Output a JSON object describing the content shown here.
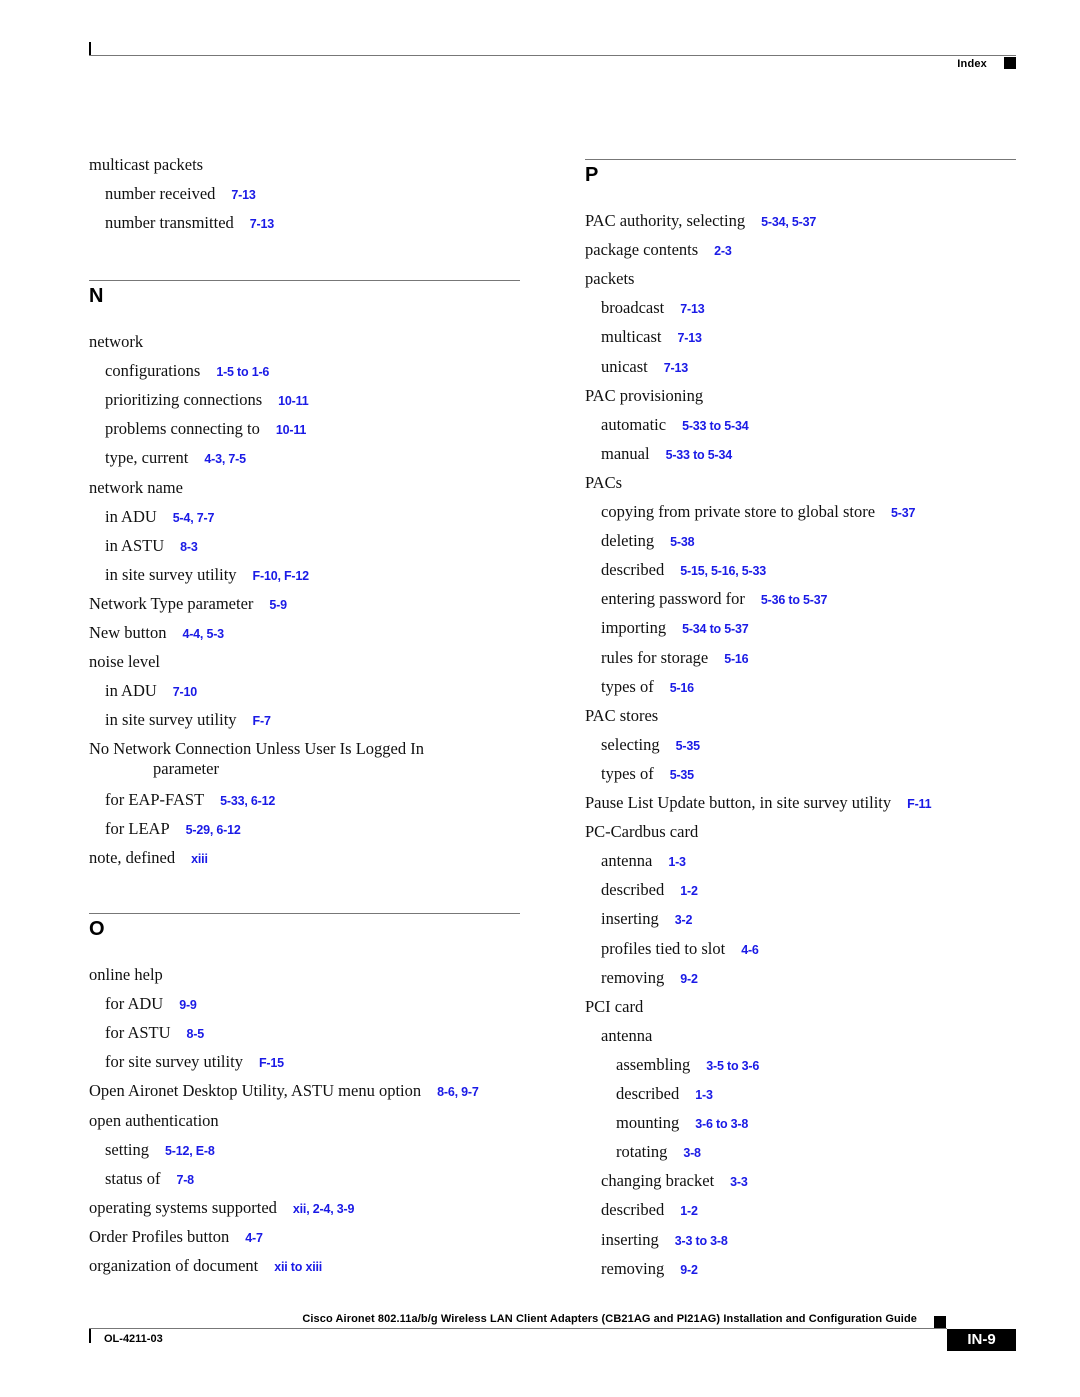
{
  "header": {
    "section_label": "Index"
  },
  "left_column": {
    "continued_entries": [
      {
        "level": 0,
        "term": "multicast packets",
        "refs": ""
      },
      {
        "level": 1,
        "term": "number received",
        "refs": "7-13"
      },
      {
        "level": 1,
        "term": "number transmitted",
        "refs": "7-13"
      }
    ],
    "sections": [
      {
        "letter": "N",
        "entries": [
          {
            "level": 0,
            "term": "network",
            "refs": ""
          },
          {
            "level": 1,
            "term": "configurations",
            "refs": "1-5 to 1-6"
          },
          {
            "level": 1,
            "term": "prioritizing connections",
            "refs": "10-11"
          },
          {
            "level": 1,
            "term": "problems connecting to",
            "refs": "10-11"
          },
          {
            "level": 1,
            "term": "type, current",
            "refs": "4-3, 7-5"
          },
          {
            "level": 0,
            "term": "network name",
            "refs": ""
          },
          {
            "level": 1,
            "term": "in ADU",
            "refs": "5-4, 7-7"
          },
          {
            "level": 1,
            "term": "in ASTU",
            "refs": "8-3"
          },
          {
            "level": 1,
            "term": "in site survey utility",
            "refs": "F-10, F-12"
          },
          {
            "level": 0,
            "term": "Network Type parameter",
            "refs": "5-9"
          },
          {
            "level": 0,
            "term": "New button",
            "refs": "4-4, 5-3"
          },
          {
            "level": 0,
            "term": "noise level",
            "refs": ""
          },
          {
            "level": 1,
            "term": "in ADU",
            "refs": "7-10"
          },
          {
            "level": 1,
            "term": "in site survey utility",
            "refs": "F-7"
          },
          {
            "level": 0,
            "term": "No Network Connection Unless User Is Logged In",
            "continuation": "parameter",
            "refs": ""
          },
          {
            "level": 1,
            "term": "for EAP-FAST",
            "refs": "5-33, 6-12"
          },
          {
            "level": 1,
            "term": "for LEAP",
            "refs": "5-29, 6-12"
          },
          {
            "level": 0,
            "term": "note, defined",
            "refs": "xiii"
          }
        ]
      },
      {
        "letter": "O",
        "entries": [
          {
            "level": 0,
            "term": "online help",
            "refs": ""
          },
          {
            "level": 1,
            "term": "for ADU",
            "refs": "9-9"
          },
          {
            "level": 1,
            "term": "for ASTU",
            "refs": "8-5"
          },
          {
            "level": 1,
            "term": "for site survey utility",
            "refs": "F-15"
          },
          {
            "level": 0,
            "term": "Open Aironet Desktop Utility, ASTU menu option",
            "refs": "8-6, 9-7"
          },
          {
            "level": 0,
            "term": "open authentication",
            "refs": ""
          },
          {
            "level": 1,
            "term": "setting",
            "refs": "5-12, E-8"
          },
          {
            "level": 1,
            "term": "status of",
            "refs": "7-8"
          },
          {
            "level": 0,
            "term": "operating systems supported",
            "refs": "xii, 2-4, 3-9"
          },
          {
            "level": 0,
            "term": "Order Profiles button",
            "refs": "4-7"
          },
          {
            "level": 0,
            "term": "organization of document",
            "refs": "xii to xiii"
          }
        ]
      }
    ]
  },
  "right_column": {
    "sections": [
      {
        "letter": "P",
        "entries": [
          {
            "level": 0,
            "term": "PAC authority, selecting",
            "refs": "5-34, 5-37"
          },
          {
            "level": 0,
            "term": "package contents",
            "refs": "2-3"
          },
          {
            "level": 0,
            "term": "packets",
            "refs": ""
          },
          {
            "level": 1,
            "term": "broadcast",
            "refs": "7-13"
          },
          {
            "level": 1,
            "term": "multicast",
            "refs": "7-13"
          },
          {
            "level": 1,
            "term": "unicast",
            "refs": "7-13"
          },
          {
            "level": 0,
            "term": "PAC provisioning",
            "refs": ""
          },
          {
            "level": 1,
            "term": "automatic",
            "refs": "5-33 to 5-34"
          },
          {
            "level": 1,
            "term": "manual",
            "refs": "5-33 to 5-34"
          },
          {
            "level": 0,
            "term": "PACs",
            "refs": ""
          },
          {
            "level": 1,
            "term": "copying from private store to global store",
            "refs": "5-37"
          },
          {
            "level": 1,
            "term": "deleting",
            "refs": "5-38"
          },
          {
            "level": 1,
            "term": "described",
            "refs": "5-15, 5-16, 5-33"
          },
          {
            "level": 1,
            "term": "entering password for",
            "refs": "5-36 to 5-37"
          },
          {
            "level": 1,
            "term": "importing",
            "refs": "5-34 to 5-37"
          },
          {
            "level": 1,
            "term": "rules for storage",
            "refs": "5-16"
          },
          {
            "level": 1,
            "term": "types of",
            "refs": "5-16"
          },
          {
            "level": 0,
            "term": "PAC stores",
            "refs": ""
          },
          {
            "level": 1,
            "term": "selecting",
            "refs": "5-35"
          },
          {
            "level": 1,
            "term": "types of",
            "refs": "5-35"
          },
          {
            "level": 0,
            "term": "Pause List Update button, in site survey utility",
            "refs": "F-11"
          },
          {
            "level": 0,
            "term": "PC-Cardbus card",
            "refs": ""
          },
          {
            "level": 1,
            "term": "antenna",
            "refs": "1-3"
          },
          {
            "level": 1,
            "term": "described",
            "refs": "1-2"
          },
          {
            "level": 1,
            "term": "inserting",
            "refs": "3-2"
          },
          {
            "level": 1,
            "term": "profiles tied to slot",
            "refs": "4-6"
          },
          {
            "level": 1,
            "term": "removing",
            "refs": "9-2"
          },
          {
            "level": 0,
            "term": "PCI card",
            "refs": ""
          },
          {
            "level": 1,
            "term": "antenna",
            "refs": ""
          },
          {
            "level": 2,
            "term": "assembling",
            "refs": "3-5 to 3-6"
          },
          {
            "level": 2,
            "term": "described",
            "refs": "1-3"
          },
          {
            "level": 2,
            "term": "mounting",
            "refs": "3-6 to 3-8"
          },
          {
            "level": 2,
            "term": "rotating",
            "refs": "3-8"
          },
          {
            "level": 1,
            "term": "changing bracket",
            "refs": "3-3"
          },
          {
            "level": 1,
            "term": "described",
            "refs": "1-2"
          },
          {
            "level": 1,
            "term": "inserting",
            "refs": "3-3 to 3-8"
          },
          {
            "level": 1,
            "term": "removing",
            "refs": "9-2"
          }
        ]
      }
    ]
  },
  "footer": {
    "guide_title": "Cisco Aironet 802.11a/b/g Wireless LAN Client Adapters (CB21AG and PI21AG) Installation and Configuration Guide",
    "doc_number": "OL-4211-03",
    "page_number": "IN-9"
  },
  "colors": {
    "reference_link": "#1a1ae6",
    "text": "#111111",
    "rule": "#777777"
  }
}
